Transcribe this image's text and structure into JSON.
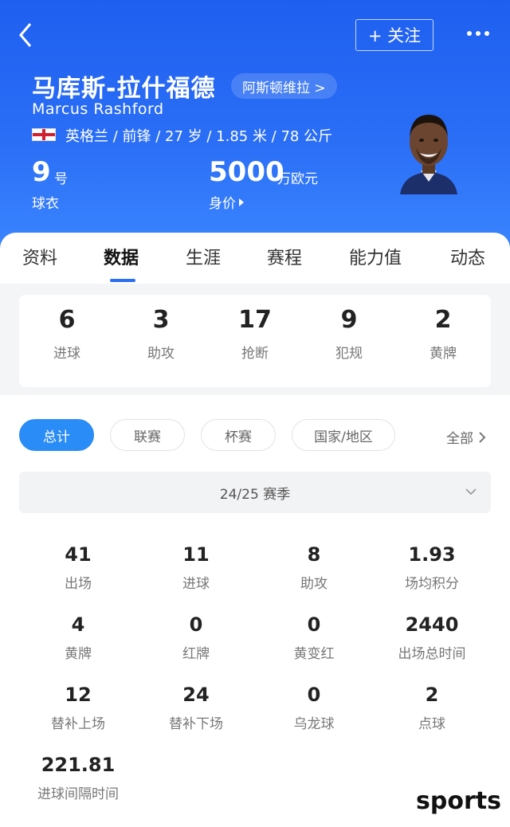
{
  "header": {
    "follow_label": "+ 关注",
    "name_cn": "马库斯-拉什福德",
    "club": "阿斯顿维拉 >",
    "name_en": "Marcus Rashford",
    "meta": "英格兰 / 前锋 / 27 岁 / 1.85 米 / 78 公斤",
    "jersey_number": "9",
    "jersey_unit": "号",
    "jersey_label": "球衣",
    "market_value": "5000",
    "market_value_unit": "万欧元",
    "market_value_label": "身价"
  },
  "tabs": [
    "资料",
    "数据",
    "生涯",
    "赛程",
    "能力值",
    "动态"
  ],
  "active_tab": "数据",
  "summary": [
    {
      "value": "6",
      "label": "进球"
    },
    {
      "value": "3",
      "label": "助攻"
    },
    {
      "value": "17",
      "label": "抢断"
    },
    {
      "value": "9",
      "label": "犯规"
    },
    {
      "value": "2",
      "label": "黄牌"
    }
  ],
  "filters": [
    "总计",
    "联赛",
    "杯赛",
    "国家/地区"
  ],
  "filter_all": "全部",
  "season": "24/25 赛季",
  "stats": [
    {
      "value": "41",
      "label": "出场"
    },
    {
      "value": "11",
      "label": "进球"
    },
    {
      "value": "8",
      "label": "助攻"
    },
    {
      "value": "1.93",
      "label": "场均积分"
    },
    {
      "value": "4",
      "label": "黄牌"
    },
    {
      "value": "0",
      "label": "红牌"
    },
    {
      "value": "0",
      "label": "黄变红"
    },
    {
      "value": "2440",
      "label": "出场总时间"
    },
    {
      "value": "12",
      "label": "替补上场"
    },
    {
      "value": "24",
      "label": "替补下场"
    },
    {
      "value": "0",
      "label": "乌龙球"
    },
    {
      "value": "2",
      "label": "点球"
    },
    {
      "value": "221.81",
      "label": "进球间隔时间"
    }
  ],
  "watermark": "sports",
  "colors": {
    "header": "#2a6ef6",
    "accent": "#2a8cf6"
  }
}
